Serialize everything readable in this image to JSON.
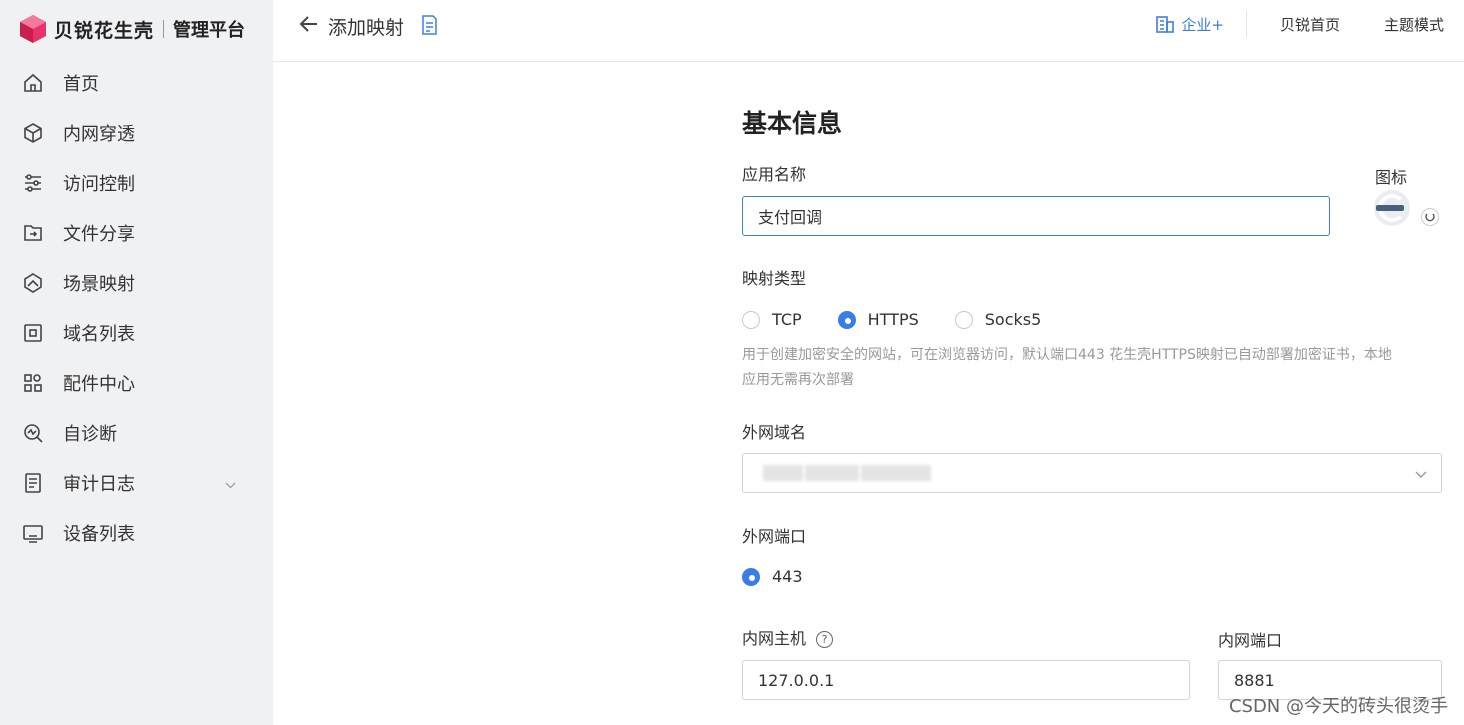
{
  "brand": {
    "name": "贝锐花生壳",
    "sub": "管理平台",
    "accent": "#e8336a"
  },
  "sidebar": {
    "items": [
      {
        "label": "首页",
        "icon": "home-icon"
      },
      {
        "label": "内网穿透",
        "icon": "cube-icon"
      },
      {
        "label": "访问控制",
        "icon": "sliders-icon"
      },
      {
        "label": "文件分享",
        "icon": "folder-share-icon"
      },
      {
        "label": "场景映射",
        "icon": "scene-icon"
      },
      {
        "label": "域名列表",
        "icon": "domain-icon"
      },
      {
        "label": "配件中心",
        "icon": "grid-icon"
      },
      {
        "label": "自诊断",
        "icon": "diagnose-icon"
      },
      {
        "label": "审计日志",
        "icon": "log-icon"
      },
      {
        "label": "设备列表",
        "icon": "monitor-icon"
      }
    ]
  },
  "header": {
    "title": "添加映射",
    "enterprise": "企业+",
    "home_link": "贝锐首页",
    "theme_link": "主题模式"
  },
  "form": {
    "section_title": "基本信息",
    "app_name_label": "应用名称",
    "app_name_value": "支付回调",
    "icon_label": "图标",
    "mapping_type_label": "映射类型",
    "mapping_types": [
      "TCP",
      "HTTPS",
      "Socks5"
    ],
    "mapping_type_selected": "HTTPS",
    "help_line1": "用于创建加密安全的网站，可在浏览器访问，默认端口443 花生壳HTTPS映射已自动部署加密证书，本地",
    "help_line2": "应用无需再次部署",
    "domain_label": "外网域名",
    "port_label": "外网端口",
    "port_value": "443",
    "host_label": "内网主机",
    "host_value": "127.0.0.1",
    "local_port_label": "内网端口",
    "local_port_value": "8881"
  },
  "watermark": "CSDN @今天的砖头很烫手",
  "colors": {
    "primary": "#3b7de8",
    "sidebar_bg": "#f0f1f3"
  }
}
